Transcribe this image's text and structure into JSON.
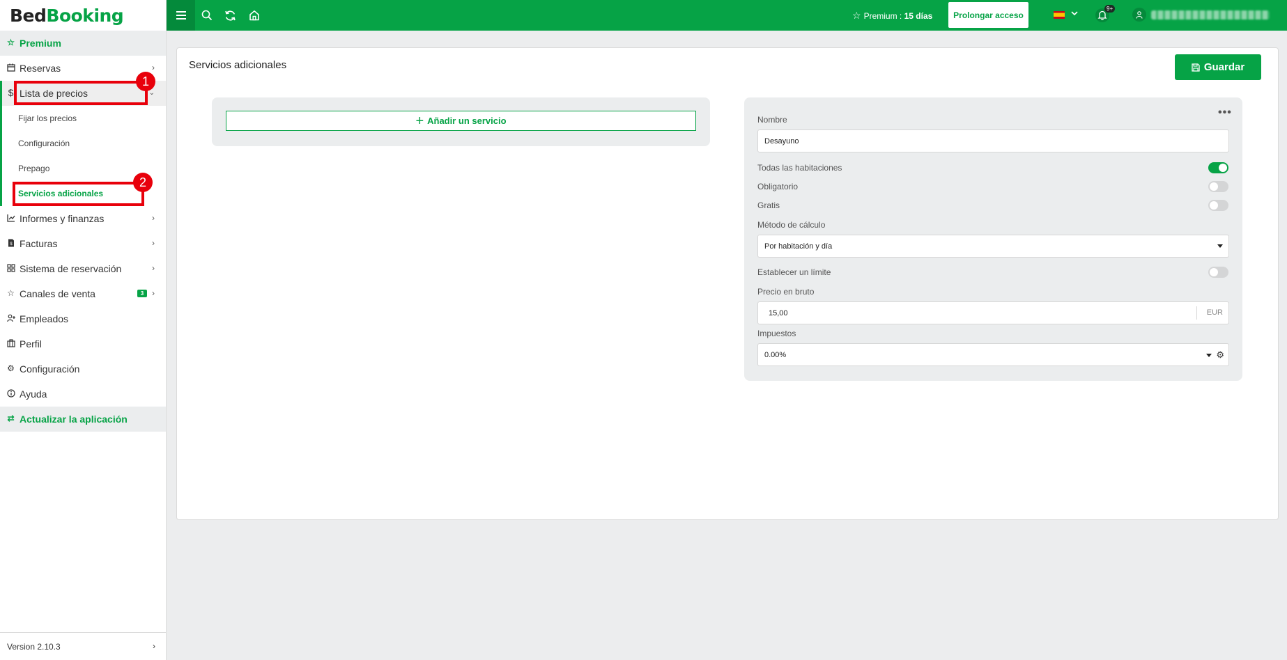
{
  "logo": {
    "part1": "Bed",
    "part2": "Booking"
  },
  "sidebar": {
    "premium": "Premium",
    "items": [
      {
        "label": "Reservas"
      },
      {
        "label": "Lista de precios"
      },
      {
        "label": "Informes y finanzas"
      },
      {
        "label": "Facturas"
      },
      {
        "label": "Sistema de reservación"
      },
      {
        "label": "Canales de venta",
        "badge": "3"
      },
      {
        "label": "Empleados"
      },
      {
        "label": "Perfil"
      },
      {
        "label": "Configuración"
      },
      {
        "label": "Ayuda"
      }
    ],
    "submenu": [
      {
        "label": "Fijar los precios"
      },
      {
        "label": "Configuración"
      },
      {
        "label": "Prepago"
      },
      {
        "label": "Servicios adicionales"
      }
    ],
    "update": "Actualizar la aplicación",
    "version": "Version 2.10.3"
  },
  "annotations": {
    "first": "1",
    "second": "2"
  },
  "topbar": {
    "premium_label": "Premium :",
    "premium_days": "15 días",
    "extend_button": "Prolongar acceso",
    "notif_badge": "9+"
  },
  "page": {
    "title": "Servicios adicionales",
    "save_button": "Guardar",
    "add_service": "Añadir un servicio"
  },
  "form": {
    "name_label": "Nombre",
    "name_value": "Desayuno",
    "all_rooms_label": "Todas las habitaciones",
    "all_rooms_on": true,
    "mandatory_label": "Obligatorio",
    "mandatory_on": false,
    "free_label": "Gratis",
    "free_on": false,
    "calc_label": "Método de cálculo",
    "calc_value": "Por habitación y día",
    "limit_label": "Establecer un límite",
    "limit_on": false,
    "gross_label": "Precio en bruto",
    "gross_value": "15,00",
    "gross_unit": "EUR",
    "tax_label": "Impuestos",
    "tax_value": "0.00%"
  },
  "colors": {
    "accent": "#06a346",
    "annotation": "#e8000b"
  }
}
